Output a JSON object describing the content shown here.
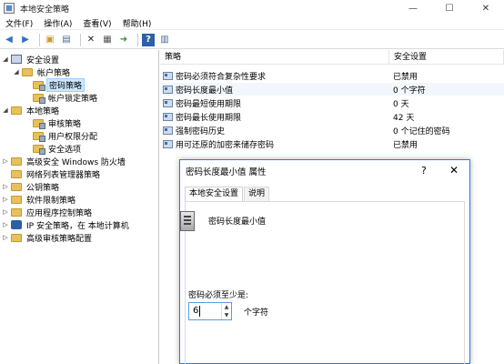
{
  "window": {
    "title": "本地安全策略",
    "minimize": "—",
    "maximize": "☐",
    "close": "✕"
  },
  "menu": [
    "文件(F)",
    "操作(A)",
    "查看(V)",
    "帮助(H)"
  ],
  "toolbar": [
    "back-arrow-icon",
    "forward-arrow-icon",
    "up-folder-icon",
    "show-hide-tree-icon",
    "delete-icon",
    "properties-icon",
    "export-icon",
    "help-icon",
    "console-icon"
  ],
  "tree": {
    "root": "安全设置",
    "account_policies": "帐户策略",
    "password_policy": "密码策略",
    "lockout_policy": "帐户锁定策略",
    "local_policies": "本地策略",
    "audit_policy": "审核策略",
    "user_rights": "用户权限分配",
    "security_options": "安全选项",
    "firewall": "高级安全 Windows 防火墙",
    "network_list": "网络列表管理器策略",
    "public_key": "公钥策略",
    "software_restriction": "软件限制策略",
    "applocker": "应用程序控制策略",
    "ipsec": "IP 安全策略，在 本地计算机",
    "advanced_audit": "高级审核策略配置"
  },
  "list": {
    "col_policy": "策略",
    "col_setting": "安全设置",
    "rows": [
      {
        "name": "密码必须符合复杂性要求",
        "value": "已禁用"
      },
      {
        "name": "密码长度最小值",
        "value": "0 个字符"
      },
      {
        "name": "密码最短使用期限",
        "value": "0 天"
      },
      {
        "name": "密码最长使用期限",
        "value": "42 天"
      },
      {
        "name": "强制密码历史",
        "value": "0 个记住的密码"
      },
      {
        "name": "用可还原的加密来储存密码",
        "value": "已禁用"
      }
    ]
  },
  "dialog": {
    "title": "密码长度最小值 属性",
    "help": "?",
    "close": "✕",
    "tab_local": "本地安全设置",
    "tab_explain": "说明",
    "policy_title": "密码长度最小值",
    "label": "密码必须至少是:",
    "value": "6",
    "unit": "个字符"
  }
}
